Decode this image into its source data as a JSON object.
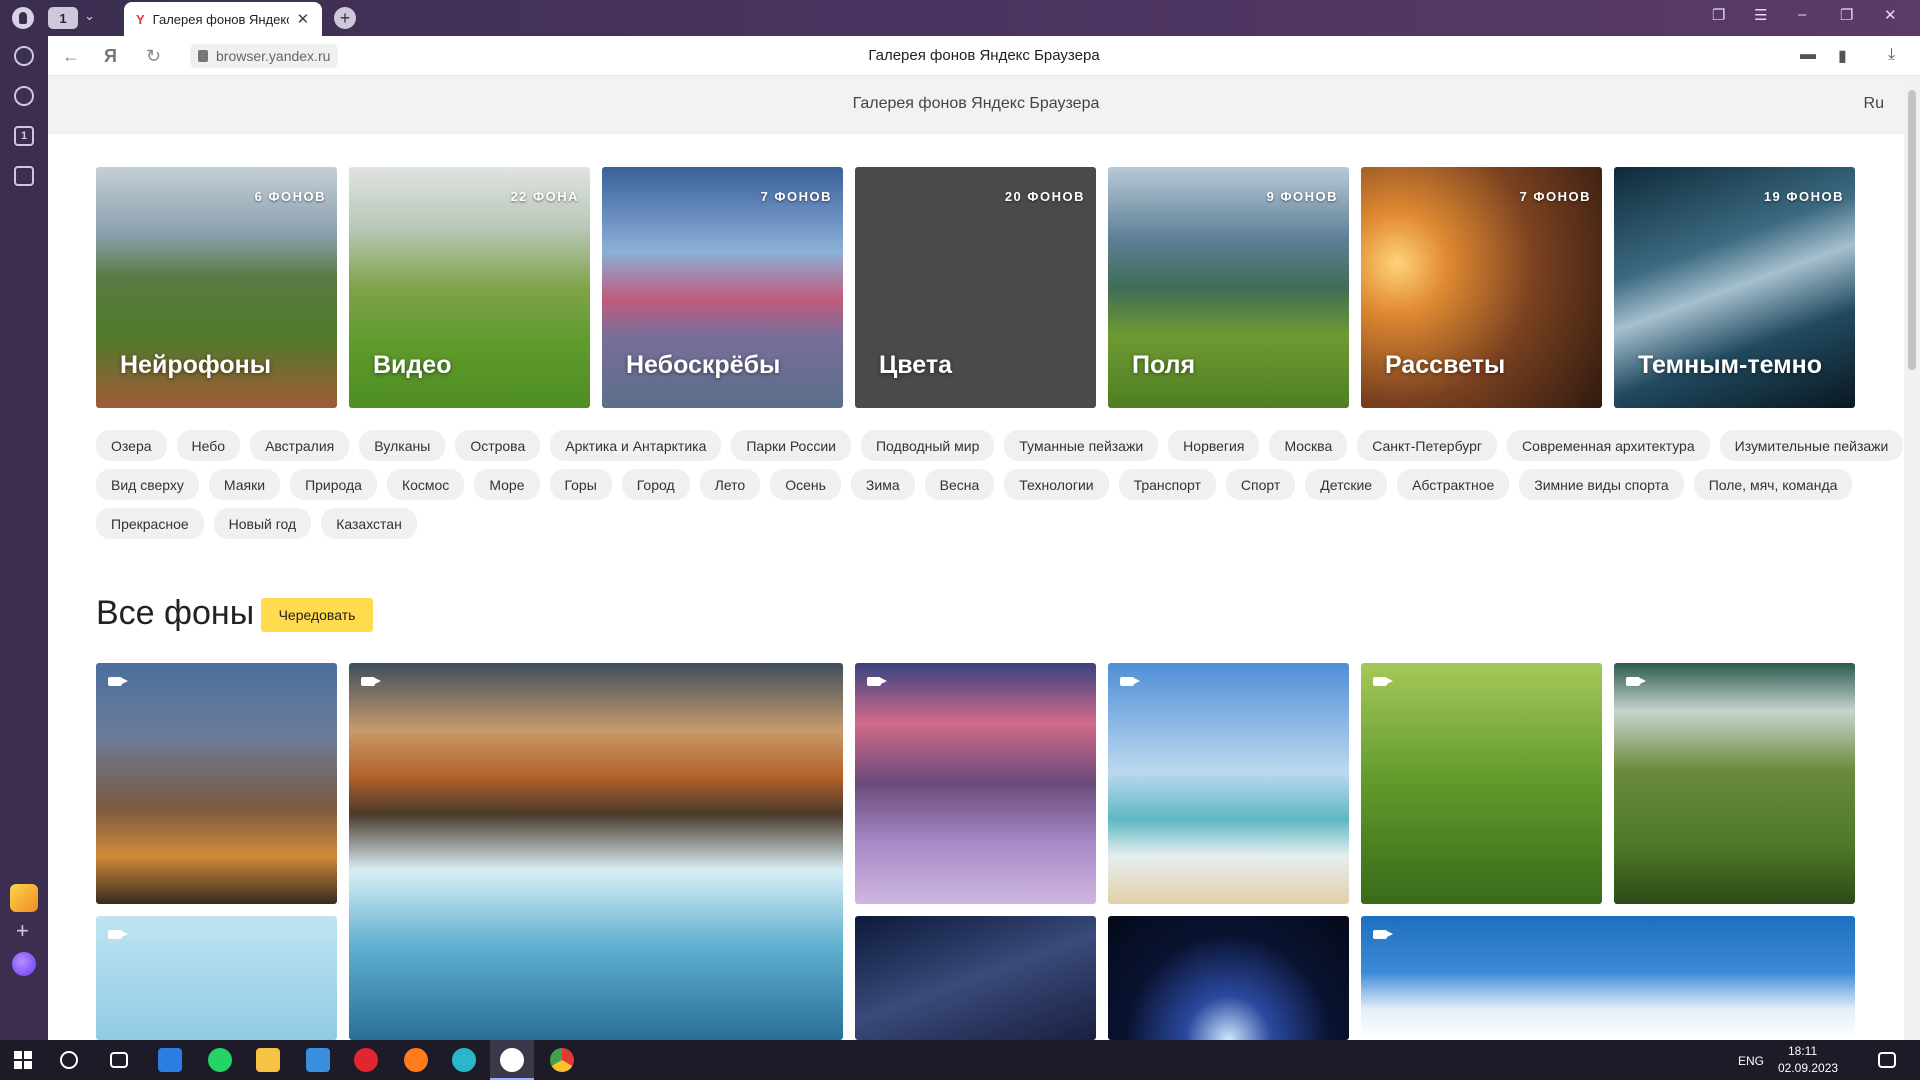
{
  "browser": {
    "profile_counter": "1",
    "tab": {
      "favicon": "Y",
      "title": "Галерея фонов Яндекс Браузера",
      "close": "✕"
    },
    "new_tab": "+",
    "url": "browser.yandex.ru",
    "page_title": "Галерея фонов Яндекс Браузера"
  },
  "page": {
    "header_title": "Галерея фонов Яндекс Браузера",
    "lang": "Ru",
    "categories": [
      {
        "name": "Нейрофоны",
        "count": "6 ФОНОВ"
      },
      {
        "name": "Видео",
        "count": "22 ФОНА"
      },
      {
        "name": "Небоскрёбы",
        "count": "7 ФОНОВ"
      },
      {
        "name": "Цвета",
        "count": "20 ФОНОВ"
      },
      {
        "name": "Поля",
        "count": "9 ФОНОВ"
      },
      {
        "name": "Рассветы",
        "count": "7 ФОНОВ"
      },
      {
        "name": "Темным-темно",
        "count": "19 ФОНОВ"
      }
    ],
    "tags_row1": [
      "Озера",
      "Небо",
      "Австралия",
      "Вулканы",
      "Острова",
      "Арктика и Антарктика",
      "Парки России",
      "Подводный мир",
      "Туманные пейзажи",
      "Норвегия",
      "Москва",
      "Санкт-Петербург",
      "Современная архитектура",
      "Изумительные пейзажи"
    ],
    "tags_row2": [
      "Вид сверху",
      "Маяки",
      "Природа",
      "Космос",
      "Море",
      "Горы",
      "Город",
      "Лето",
      "Осень",
      "Зима",
      "Весна",
      "Технологии",
      "Транспорт",
      "Спорт",
      "Детские",
      "Абстрактное",
      "Зимние виды спорта",
      "Поле, мяч, команда"
    ],
    "tags_row3": [
      "Прекрасное",
      "Новый год",
      "Казахстан"
    ],
    "all_title": "Все фоны",
    "shuffle_label": "Чередовать"
  },
  "taskbar": {
    "lang": "ENG",
    "time": "18:11",
    "date": "02.09.2023"
  },
  "colors": {
    "accent": "#ffdb4d",
    "browser_frame": "#3b2e50"
  }
}
